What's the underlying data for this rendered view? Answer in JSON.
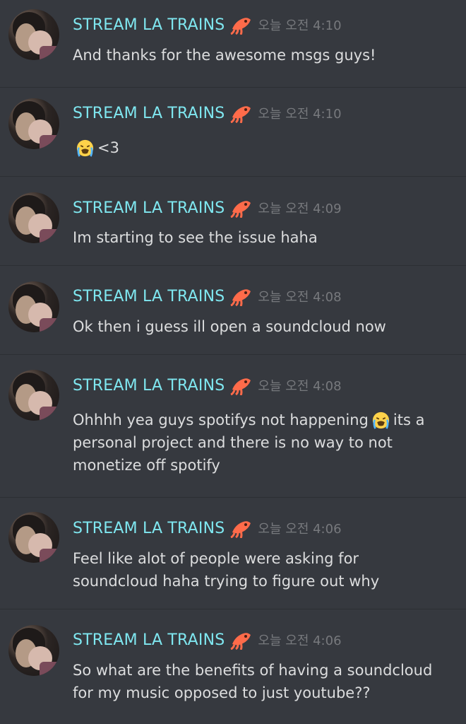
{
  "messages": [
    {
      "author": "STREAM LA TRAINS",
      "timestamp": "오늘 오전 4:10",
      "badge_icon": "squid-emoji",
      "content": [
        "And thanks for the awesome msgs guys!"
      ]
    },
    {
      "author": "STREAM LA TRAINS",
      "timestamp": "오늘 오전 4:10",
      "badge_icon": "squid-emoji",
      "content_emoji": "loudly-crying-face-emoji",
      "content_after_emoji": "<3"
    },
    {
      "author": "STREAM LA TRAINS",
      "timestamp": "오늘 오전 4:09",
      "badge_icon": "squid-emoji",
      "content": [
        "Im starting to see the issue haha"
      ]
    },
    {
      "author": "STREAM LA TRAINS",
      "timestamp": "오늘 오전 4:08",
      "badge_icon": "squid-emoji",
      "content": [
        "Ok then i guess ill open a soundcloud now"
      ]
    },
    {
      "author": "STREAM LA TRAINS",
      "timestamp": "오늘 오전 4:08",
      "badge_icon": "squid-emoji",
      "content_line1_before_emoji": "Ohhhh yea guys spotifys not happening",
      "content_emoji": "loudly-crying-face-emoji",
      "content_line1_after_emoji": "its a",
      "content_more": [
        "personal project and there is no way to not",
        "monetize off spotify"
      ]
    },
    {
      "author": "STREAM LA TRAINS",
      "timestamp": "오늘 오전 4:06",
      "badge_icon": "squid-emoji",
      "content": [
        "Feel like alot of people were asking for",
        "soundcloud haha trying to figure out why"
      ]
    },
    {
      "author": "STREAM LA TRAINS",
      "timestamp": "오늘 오전 4:06",
      "badge_icon": "squid-emoji",
      "content": [
        "So what are the benefits of having a soundcloud",
        "for my music opposed to just youtube??"
      ]
    }
  ],
  "theme": {
    "background": "#36393f",
    "username_color": "#7fe7f0",
    "timestamp_color": "#77797d",
    "text_color": "#dcddde"
  }
}
